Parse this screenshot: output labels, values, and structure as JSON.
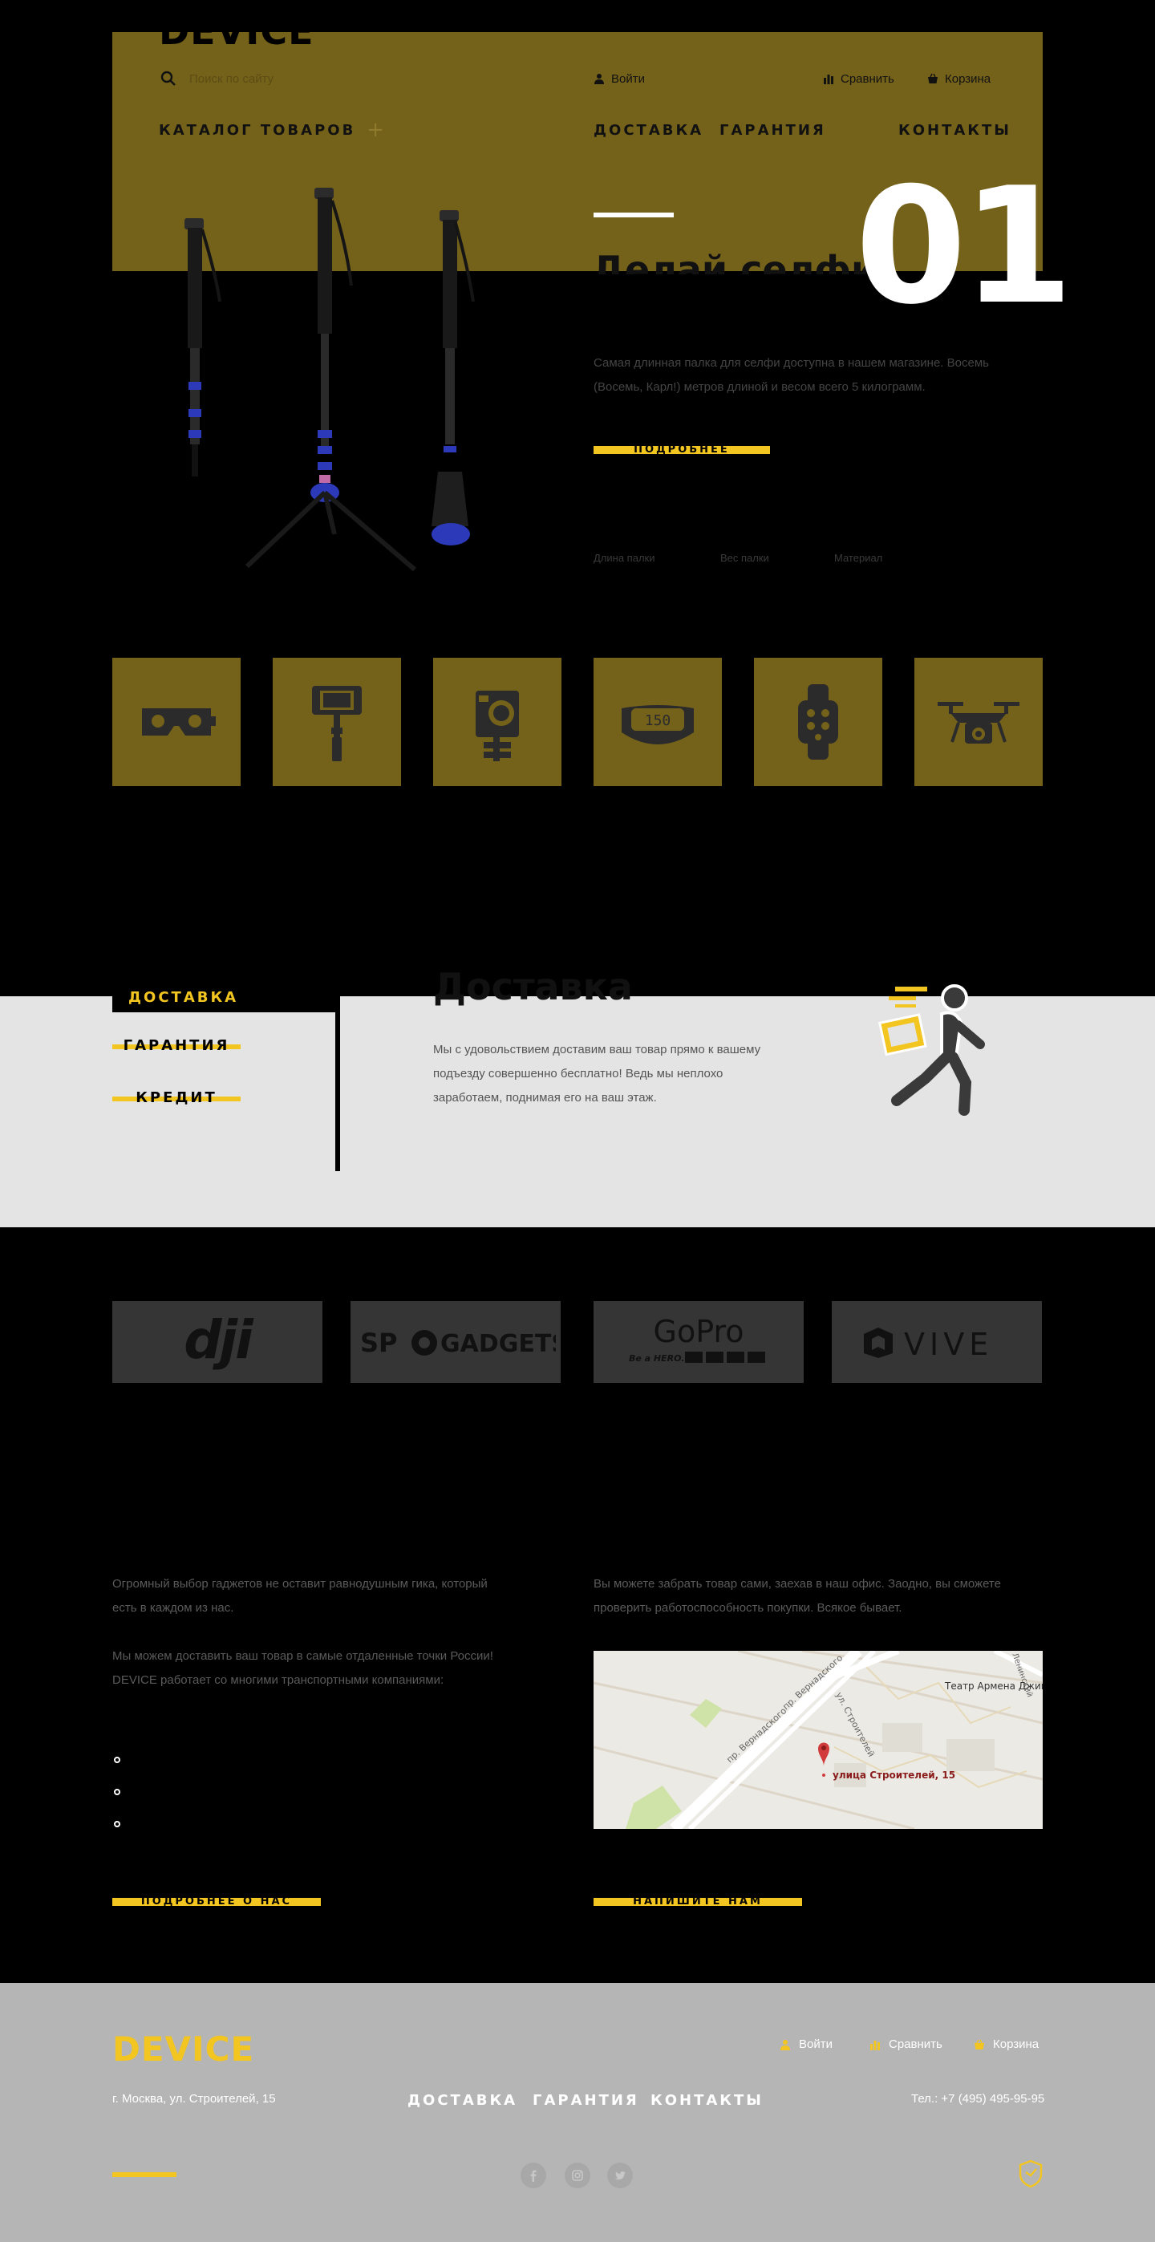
{
  "header": {
    "logo": "DEVICE",
    "search_placeholder": "Поиск по сайту",
    "login": "Войти",
    "compare": "Сравнить",
    "cart": "Корзина",
    "catalog": "КАТАЛОГ ТОВАРОВ",
    "catalog_plus": "+",
    "nav": [
      "ДОСТАВКА",
      "ГАРАНТИЯ",
      "КОНТАКТЫ"
    ]
  },
  "hero": {
    "number": "01",
    "title": "Делай селфи",
    "description": "Самая длинная палка для селфи доступна в нашем магазине. Восемь (Восемь, Карл!) метров длиной и весом всего 5 килограмм.",
    "button": "ПОДРОБНЕЕ",
    "specs": [
      "Длина палки",
      "Вес палки",
      "Материал"
    ]
  },
  "categories": [
    "vr-headset-icon",
    "selfie-stick-icon",
    "action-camera-icon",
    "fitness-tracker-icon",
    "smartwatch-icon",
    "drone-icon"
  ],
  "fitness_display": "150",
  "services": {
    "tabs": [
      "ДОСТАВКА",
      "ГАРАНТИЯ",
      "КРЕДИТ"
    ],
    "title": "Доставка",
    "text": "Мы с удовольствием доставим ваш товар прямо к вашему подъезду совершенно бесплатно! Ведь мы неплохо заработаем, поднимая его на ваш этаж."
  },
  "brands": {
    "dji": "dji",
    "sp_gadgets": [
      "SP",
      "GADGETS"
    ],
    "gopro": "GoPro",
    "gopro_tagline": "Be a HERO.",
    "vive": "VIVE"
  },
  "about": {
    "para1": "Огромный выбор гаджетов не оставит равнодушным гика, который есть в каждом из нас.",
    "para2": "Мы можем доставить ваш товар в самые отдаленные точки России! DEVICE работает со многими транспортными компаниями:",
    "button": "ПОДРОБНЕЕ О НАС"
  },
  "contacts": {
    "text": "Вы можете забрать товар сами, заехав в наш офис. Заодно, вы сможете проверить работоспособность покупки. Всякое бывает.",
    "button": "НАПИШИТЕ НАМ",
    "map": {
      "marker_label": "улица Строителей, 15",
      "poi": "Театр Армена Джигарханяна",
      "streets": [
        "пр. Вернадского",
        "пр. Вернадского",
        "ул. Строителей",
        "Ленинский"
      ]
    }
  },
  "footer": {
    "logo": "DEVICE",
    "address": "г. Москва, ул. Строителей, 15",
    "nav": [
      "ДОСТАВКА",
      "ГАРАНТИЯ",
      "КОНТАКТЫ"
    ],
    "login": "Войти",
    "compare": "Сравнить",
    "cart": "Корзина",
    "phone": "Тел.: +7 (495) 495-95-95",
    "social": [
      "facebook-icon",
      "instagram-icon",
      "twitter-icon"
    ]
  },
  "colors": {
    "accent": "#f3c520",
    "header_bg": "#75621a",
    "footer_bg": "#b5b5b5",
    "tile_bg": "#75621a",
    "brand_bg": "#353535"
  }
}
